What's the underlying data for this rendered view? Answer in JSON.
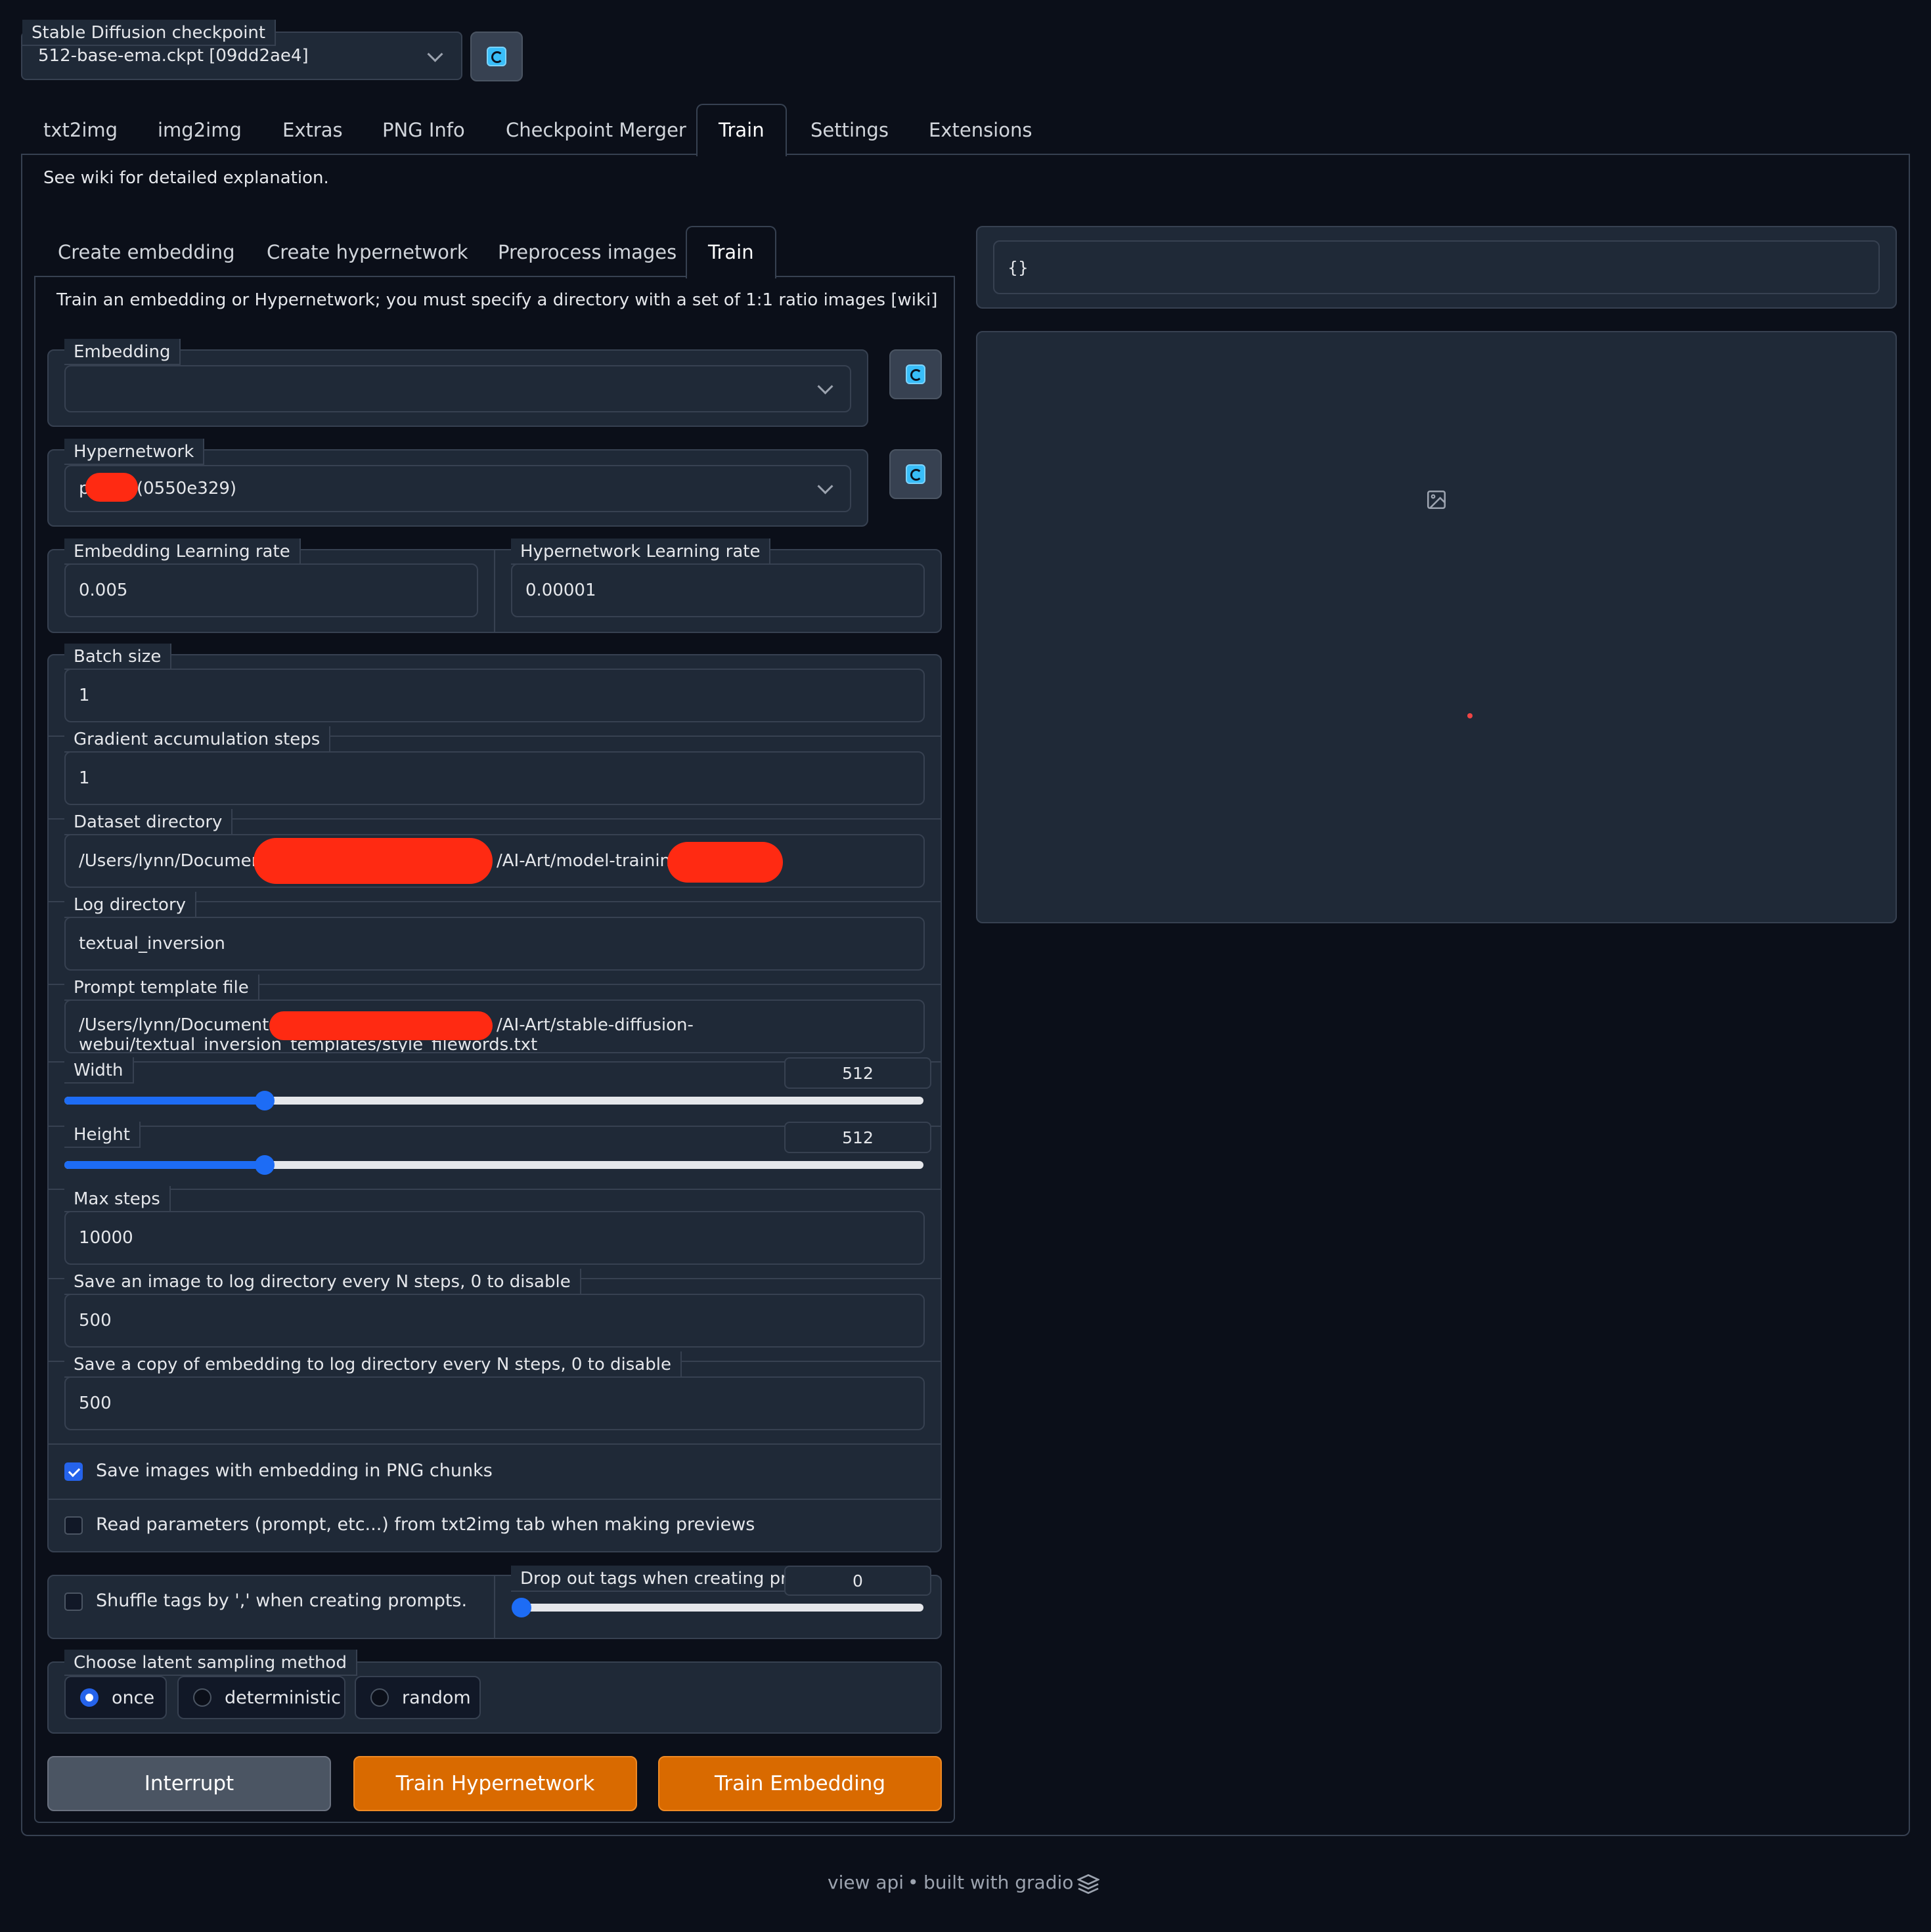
{
  "checkpoint": {
    "label": "Stable Diffusion checkpoint",
    "value": "512-base-ema.ckpt [09dd2ae4]"
  },
  "main_tabs": [
    "txt2img",
    "img2img",
    "Extras",
    "PNG Info",
    "Checkpoint Merger",
    "Train",
    "Settings",
    "Extensions"
  ],
  "main_tab_selected": "Train",
  "wiki_note": "See wiki for detailed explanation.",
  "sub_tabs": [
    "Create embedding",
    "Create hypernetwork",
    "Preprocess images",
    "Train"
  ],
  "sub_tab_selected": "Train",
  "train_desc": "Train an embedding or Hypernetwork; you must specify a directory with a set of 1:1 ratio images [wiki]",
  "embedding": {
    "label": "Embedding",
    "value": ""
  },
  "hypernetwork": {
    "label": "Hypernetwork",
    "value_prefix": "p",
    "value_suffix": "(0550e329)"
  },
  "emb_lr": {
    "label": "Embedding Learning rate",
    "value": "0.005"
  },
  "hyp_lr": {
    "label": "Hypernetwork Learning rate",
    "value": "0.00001"
  },
  "batch_size": {
    "label": "Batch size",
    "value": "1"
  },
  "grad_accum": {
    "label": "Gradient accumulation steps",
    "value": "1"
  },
  "dataset_dir": {
    "label": "Dataset directory",
    "value_a": "/Users/lynn/Document",
    "value_b": "/AI-Art/model-training/l"
  },
  "log_dir": {
    "label": "Log directory",
    "value": "textual_inversion"
  },
  "prompt_template": {
    "label": "Prompt template file",
    "line1_a": "/Users/lynn/Documents/L",
    "line1_b": "/AI-Art/stable-diffusion-",
    "line2": "webui/textual_inversion_templates/style_filewords.txt"
  },
  "width": {
    "label": "Width",
    "value": "512",
    "fraction": 0.233
  },
  "height": {
    "label": "Height",
    "value": "512",
    "fraction": 0.233
  },
  "max_steps": {
    "label": "Max steps",
    "value": "10000"
  },
  "save_image_every": {
    "label": "Save an image to log directory every N steps, 0 to disable",
    "value": "500"
  },
  "save_embedding_every": {
    "label": "Save a copy of embedding to log directory every N steps, 0 to disable",
    "value": "500"
  },
  "cb_save_png": {
    "label": "Save images with embedding in PNG chunks",
    "checked": true
  },
  "cb_read_params": {
    "label": "Read parameters (prompt, etc...) from txt2img tab when making previews",
    "checked": false
  },
  "cb_shuffle": {
    "label": "Shuffle tags by ',' when creating prompts.",
    "checked": false
  },
  "dropout": {
    "label": "Drop out tags when creating prompts.",
    "value": "0",
    "fraction": 0.0
  },
  "latent": {
    "label": "Choose latent sampling method",
    "options": [
      "once",
      "deterministic",
      "random"
    ],
    "selected": "once"
  },
  "buttons": {
    "interrupt": "Interrupt",
    "train_hyper": "Train Hypernetwork",
    "train_emb": "Train Embedding"
  },
  "output_json": "{}",
  "footer": {
    "view_api": "view api",
    "dot": "•",
    "built_with": "built with gradio"
  },
  "colors": {
    "accent": "#2563eb",
    "orange": "#d96a00",
    "bg": "#0b0f19",
    "panel": "#1f2937"
  }
}
